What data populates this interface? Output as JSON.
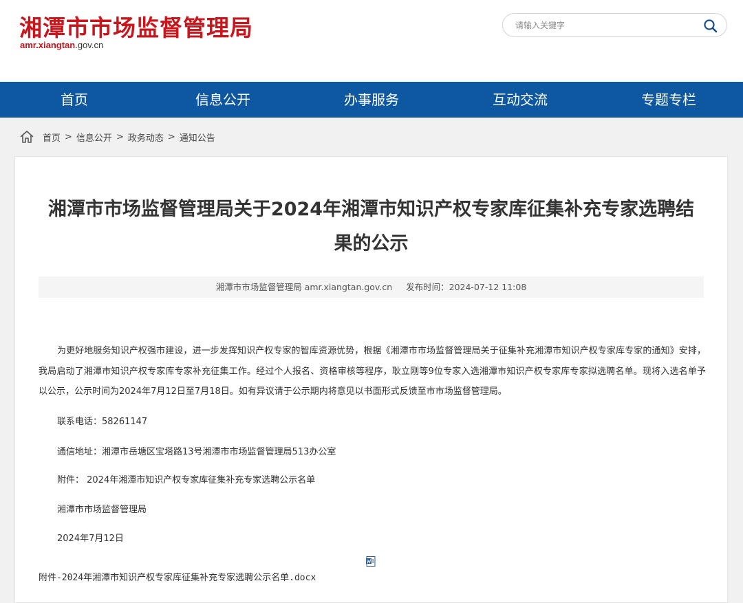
{
  "header": {
    "site_title": "湘潭市市场监督管理局",
    "domain_prefix": "amr.",
    "domain_main": "xiangtan",
    "domain_suffix": ".gov.cn",
    "search_placeholder": "请输入关键字",
    "search_icon": "search-icon"
  },
  "nav": {
    "items": [
      "首页",
      "信息公开",
      "办事服务",
      "互动交流",
      "专题专栏"
    ]
  },
  "breadcrumb": {
    "icon": "home-icon",
    "items": [
      "首页",
      "信息公开",
      "政务动态",
      "通知公告"
    ],
    "separator": ">"
  },
  "article": {
    "title": "湘潭市市场监督管理局关于2024年湘潭市知识产权专家库征集补充专家选聘结果的公示",
    "source": "湘潭市市场监督管理局 amr.xiangtan.gov.cn",
    "publish_time": "发布时间：2024-07-12 11:08",
    "body": "为更好地服务知识产权强市建设，进一步发挥知识产权专家的智库资源优势，根据《湘潭市市场监督管理局关于征集补充湘潭市知识产权专家库专家的通知》安排，我局启动了湘潭市知识产权专家库专家补充征集工作。经过个人报名、资格审核等程序，耿立刚等9位专家入选湘潭市知识产权专家库专家拟选聘名单。现将入选名单予以公示，公示时间为2024年7月12日至7月18日。如有异议请于公示期内将意见以书面形式反馈至市市场监督管理局。",
    "phone": "联系电话：58261147",
    "address": "通信地址：湘潭市岳塘区宝塔路13号湘潭市市场监督管理局513办公室",
    "attachment_line": "附件：  2024年湘潭市知识产权专家库征集补充专家选聘公示名单",
    "signature": "湘潭市市场监督管理局",
    "date": "2024年7月12日",
    "attachment_file": "附件-2024年湘潭市知识产权专家库征集补充专家选聘公示名单.docx",
    "attachment_icon": "word-doc-icon"
  },
  "colors": {
    "brand_red": "#c8161d",
    "nav_blue": "#0e57a1",
    "page_bg": "#f1f1f1",
    "meta_bg": "#f5f5f5"
  }
}
